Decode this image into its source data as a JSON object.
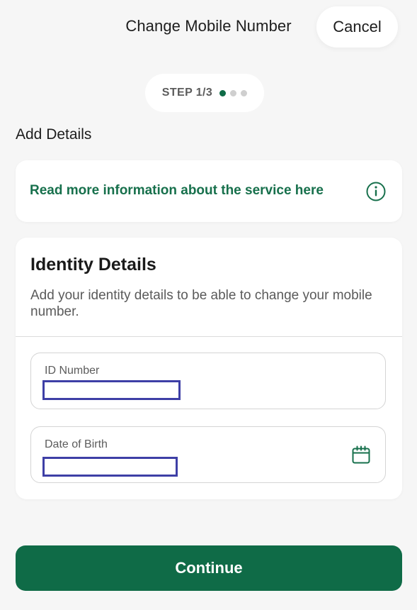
{
  "header": {
    "title": "Change Mobile Number",
    "cancel_label": "Cancel"
  },
  "stepper": {
    "label": "STEP 1/3",
    "total_steps": 3,
    "current_step": 1
  },
  "section_heading": "Add Details",
  "info_card": {
    "link_text": "Read more information about the service here",
    "icon": "info-circle-icon"
  },
  "identity": {
    "title": "Identity Details",
    "description": "Add your identity details to be able to change your mobile number.",
    "fields": {
      "id_number": {
        "label": "ID Number",
        "value": ""
      },
      "date_of_birth": {
        "label": "Date of Birth",
        "value": "",
        "icon": "calendar-icon"
      }
    }
  },
  "continue_label": "Continue",
  "colors": {
    "brand_green": "#0f6b47",
    "link_green": "#17704c",
    "background": "#f6f6f6",
    "redaction_border": "#3e3fa6"
  }
}
